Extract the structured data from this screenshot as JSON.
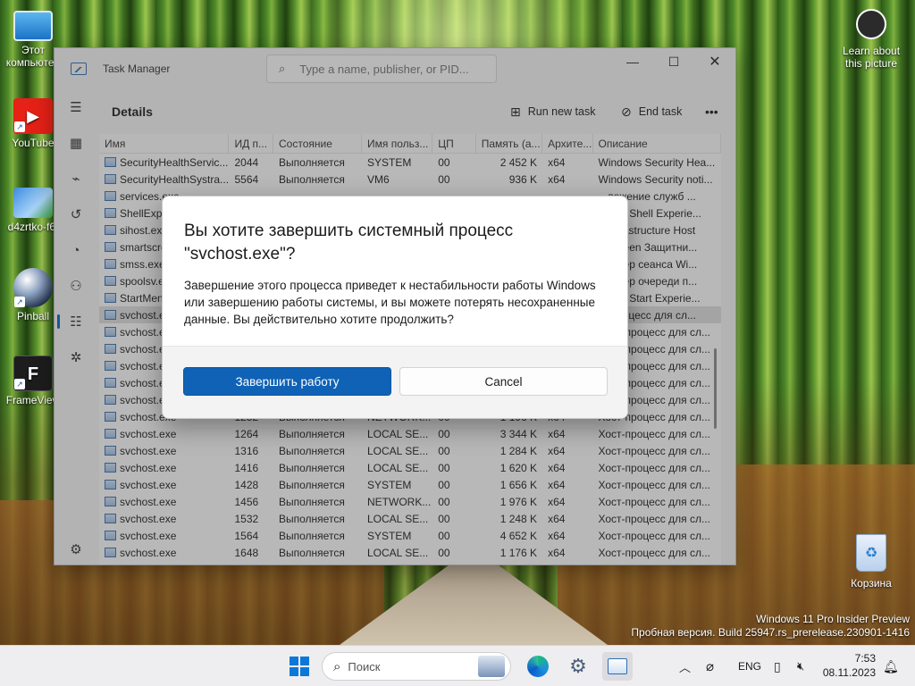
{
  "desktop": {
    "icons": [
      {
        "label": "Этот компьютер",
        "icon": "monitor-icon"
      },
      {
        "label": "YouTube",
        "icon": "youtube-icon"
      },
      {
        "label": "d4zrtko-f6f",
        "icon": "image-icon"
      },
      {
        "label": "Pinball",
        "icon": "pinball-icon"
      },
      {
        "label": "FrameView",
        "icon": "frameview-icon"
      }
    ],
    "learn_line1": "Learn about",
    "learn_line2": "this picture",
    "recycle_bin": "Корзина",
    "watermark_line1": "Windows 11 Pro Insider Preview",
    "watermark_line2": "Пробная версия. Build 25947.rs_prerelease.230901-1416"
  },
  "task_manager": {
    "title": "Task Manager",
    "search_placeholder": "Type a name, publisher, or PID...",
    "page_title": "Details",
    "run_new_task": "Run new task",
    "end_task": "End task",
    "more": "•••",
    "columns": [
      "Имя",
      "ИД п...",
      "Состояние",
      "Имя польз...",
      "ЦП",
      "Память (а...",
      "Архите...",
      "Описание"
    ],
    "rows": [
      {
        "name": "SecurityHealthServic...",
        "pid": "2044",
        "status": "Выполняется",
        "user": "SYSTEM",
        "cpu": "00",
        "mem": "2 452 K",
        "arch": "x64",
        "desc": "Windows Security Hea..."
      },
      {
        "name": "SecurityHealthSystra...",
        "pid": "5564",
        "status": "Выполняется",
        "user": "VM6",
        "cpu": "00",
        "mem": "936 K",
        "arch": "x64",
        "desc": "Windows Security noti..."
      },
      {
        "name": "services.exe",
        "pid": "",
        "status": "",
        "user": "",
        "cpu": "",
        "mem": "",
        "arch": "",
        "desc": "...ложение служб ..."
      },
      {
        "name": "ShellExpe...",
        "pid": "",
        "status": "",
        "user": "",
        "cpu": "",
        "mem": "",
        "arch": "",
        "desc": "...ows Shell Experie..."
      },
      {
        "name": "sihost.exe",
        "pid": "",
        "status": "",
        "user": "",
        "cpu": "",
        "mem": "",
        "arch": "",
        "desc": "...Infrastructure Host"
      },
      {
        "name": "smartscre...",
        "pid": "",
        "status": "",
        "user": "",
        "cpu": "",
        "mem": "",
        "arch": "",
        "desc": "...Screen Защитни..."
      },
      {
        "name": "smss.exe",
        "pid": "",
        "status": "",
        "user": "",
        "cpu": "",
        "mem": "",
        "arch": "",
        "desc": "...етчер сеанса Wi..."
      },
      {
        "name": "spoolsv.e...",
        "pid": "",
        "status": "",
        "user": "",
        "cpu": "",
        "mem": "",
        "arch": "",
        "desc": "...етчер очереди п..."
      },
      {
        "name": "StartMen...",
        "pid": "",
        "status": "",
        "user": "",
        "cpu": "",
        "mem": "",
        "arch": "",
        "desc": "...ows Start Experie..."
      },
      {
        "name": "svchost.e...",
        "pid": "",
        "status": "",
        "user": "",
        "cpu": "",
        "mem": "",
        "arch": "",
        "desc": "...-процесс для сл..."
      },
      {
        "name": "svchost.e...",
        "pid": "",
        "status": "",
        "user": "",
        "cpu": "",
        "mem": "",
        "arch": "",
        "desc": "Хост-процесс для сл..."
      },
      {
        "name": "svchost.e...",
        "pid": "",
        "status": "",
        "user": "",
        "cpu": "",
        "mem": "",
        "arch": "",
        "desc": "Хост-процесс для сл..."
      },
      {
        "name": "svchost.e...",
        "pid": "",
        "status": "",
        "user": "",
        "cpu": "",
        "mem": "",
        "arch": "",
        "desc": "Хост-процесс для сл..."
      },
      {
        "name": "svchost.e...",
        "pid": "",
        "status": "",
        "user": "",
        "cpu": "",
        "mem": "",
        "arch": "",
        "desc": "Хост-процесс для сл..."
      },
      {
        "name": "svchost.e...",
        "pid": "",
        "status": "",
        "user": "",
        "cpu": "",
        "mem": "",
        "arch": "",
        "desc": "Хост-процесс для сл..."
      },
      {
        "name": "svchost.exe",
        "pid": "1252",
        "status": "Выполняется",
        "user": "NETWORK...",
        "cpu": "00",
        "mem": "1 196 K",
        "arch": "x64",
        "desc": "Хост-процесс для сл..."
      },
      {
        "name": "svchost.exe",
        "pid": "1264",
        "status": "Выполняется",
        "user": "LOCAL SE...",
        "cpu": "00",
        "mem": "3 344 K",
        "arch": "x64",
        "desc": "Хост-процесс для сл..."
      },
      {
        "name": "svchost.exe",
        "pid": "1316",
        "status": "Выполняется",
        "user": "LOCAL SE...",
        "cpu": "00",
        "mem": "1 284 K",
        "arch": "x64",
        "desc": "Хост-процесс для сл..."
      },
      {
        "name": "svchost.exe",
        "pid": "1416",
        "status": "Выполняется",
        "user": "LOCAL SE...",
        "cpu": "00",
        "mem": "1 620 K",
        "arch": "x64",
        "desc": "Хост-процесс для сл..."
      },
      {
        "name": "svchost.exe",
        "pid": "1428",
        "status": "Выполняется",
        "user": "SYSTEM",
        "cpu": "00",
        "mem": "1 656 K",
        "arch": "x64",
        "desc": "Хост-процесс для сл..."
      },
      {
        "name": "svchost.exe",
        "pid": "1456",
        "status": "Выполняется",
        "user": "NETWORK...",
        "cpu": "00",
        "mem": "1 976 K",
        "arch": "x64",
        "desc": "Хост-процесс для сл..."
      },
      {
        "name": "svchost.exe",
        "pid": "1532",
        "status": "Выполняется",
        "user": "LOCAL SE...",
        "cpu": "00",
        "mem": "1 248 K",
        "arch": "x64",
        "desc": "Хост-процесс для сл..."
      },
      {
        "name": "svchost.exe",
        "pid": "1564",
        "status": "Выполняется",
        "user": "SYSTEM",
        "cpu": "00",
        "mem": "4 652 K",
        "arch": "x64",
        "desc": "Хост-процесс для сл..."
      },
      {
        "name": "svchost.exe",
        "pid": "1648",
        "status": "Выполняется",
        "user": "LOCAL SE...",
        "cpu": "00",
        "mem": "1 176 K",
        "arch": "x64",
        "desc": "Хост-процесс для сл..."
      }
    ],
    "selected_row": 9
  },
  "dialog": {
    "title": "Вы хотите завершить системный процесс \"svchost.exe\"?",
    "text": "Завершение этого процесса приведет к нестабильности работы Windows или завершению работы системы, и вы можете потерять несохраненные данные. Вы действительно хотите продолжить?",
    "confirm": "Завершить работу",
    "cancel": "Cancel"
  },
  "taskbar": {
    "search_placeholder": "Поиск",
    "language": "ENG",
    "time": "7:53",
    "date": "08.11.2023"
  },
  "colors": {
    "accent": "#0f62b5",
    "windows_blue": "#0a78d7"
  }
}
